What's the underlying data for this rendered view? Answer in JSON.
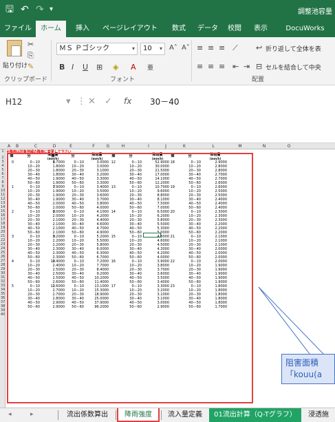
{
  "titlebar": {
    "save_icon": "save-icon",
    "undo_icon": "undo-icon",
    "redo_icon": "redo-icon",
    "customize_icon": "customize-icon",
    "window_title": "調整池容量"
  },
  "tabs": [
    "ファイル",
    "ホーム",
    "挿入",
    "ページレイアウト",
    "数式",
    "データ",
    "校閲",
    "表示",
    "DocuWorks"
  ],
  "active_tab": "ホーム",
  "ribbon": {
    "paste_label": "貼り付け",
    "clipboard_group": "クリップボード",
    "font_name": "ＭＳ Ｐゴシック",
    "font_size": "10",
    "font_group": "フォント",
    "wrap_text": "折り返して全体を表",
    "merge_center": "セルを結合して中央",
    "align_group": "配置"
  },
  "formula_bar": {
    "cell_ref": "H12",
    "fx": "fx",
    "value": "30－40"
  },
  "sheet": {
    "columns": [
      "A",
      "B",
      "C",
      "D",
      "E",
      "F",
      "G",
      "H",
      "I",
      "J",
      "K",
      "L",
      "M",
      "N",
      "O"
    ],
    "note": "※降雨は対象地域の降雨に変更して下さい",
    "headers": {
      "kou": "降",
      "bun": "分",
      "ryo": "降雨量",
      "unit": "(mm/h)"
    },
    "minutes": [
      "0－10",
      "10－20",
      "20－30",
      "30－40",
      "40－50",
      "50－60"
    ],
    "blocks": [
      {
        "row": 3,
        "groups": [
          {
            "n": "0",
            "v": [
              "1.7000",
              "1.8000",
              "1.8000",
              "1.8000",
              "1.9000",
              "1.9000"
            ]
          },
          {
            "n": "6",
            "v": [
              "3.0000",
              "3.0000",
              "3.1000",
              "3.2000",
              "3.3000",
              "3.3000"
            ]
          },
          {
            "n": "12",
            "v": [
              "52.9000",
              "30.0000",
              "21.5000",
              "17.0000",
              "14.1000",
              "12.2000"
            ]
          },
          {
            "n": "18",
            "v": [
              "2.9000",
              "2.8000",
              "2.8000",
              "2.7000",
              "2.7000",
              "2.6000"
            ]
          }
        ]
      },
      {
        "row": 9,
        "groups": [
          {
            "n": "1",
            "v": [
              "1.9000",
              "1.9000",
              "1.9000",
              "1.9000",
              "2.0000",
              "2.0000"
            ]
          },
          {
            "n": "7",
            "v": [
              "3.4000",
              "3.5000",
              "3.6000",
              "3.7000",
              "3.8000",
              "4.0000"
            ]
          },
          {
            "n": "13",
            "v": [
              "10.7000",
              "9.6000",
              "8.8000",
              "8.1000",
              "7.5000",
              "7.0000"
            ]
          },
          {
            "n": "19",
            "v": [
              "2.6000",
              "2.5000",
              "2.5000",
              "2.4000",
              "2.4000",
              "2.4000"
            ]
          }
        ]
      },
      {
        "row": 15,
        "groups": [
          {
            "n": "2",
            "v": [
              "2.0000",
              "2.0000",
              "2.1000",
              "2.1000",
              "2.1000",
              "2.1000"
            ]
          },
          {
            "n": "8",
            "v": [
              "4.1000",
              "4.2000",
              "4.4000",
              "4.6000",
              "4.7000",
              "4.9000"
            ]
          },
          {
            "n": "14",
            "v": [
              "6.5000",
              "6.2000",
              "5.8000",
              "5.5000",
              "5.3000",
              "5.0000"
            ]
          },
          {
            "n": "20",
            "v": [
              "2.3000",
              "2.3000",
              "2.3000",
              "2.2000",
              "2.2000",
              "2.2000"
            ]
          }
        ]
      },
      {
        "row": 21,
        "groups": [
          {
            "n": "3",
            "v": [
              "2.2000",
              "2.2000",
              "2.2000",
              "2.3000",
              "2.3000",
              "2.3000"
            ]
          },
          {
            "n": "9",
            "v": [
              "5.2000",
              "5.5000",
              "5.8000",
              "6.0000",
              "6.3000",
              "6.7000"
            ]
          },
          {
            "n": "15",
            "v": [
              "4.8000",
              "4.6000",
              "4.5000",
              "4.3000",
              "4.2000",
              "4.0000"
            ]
          },
          {
            "n": "21",
            "v": [
              "2.1000",
              "2.1000",
              "2.1000",
              "2.0000",
              "2.0000",
              "2.0000"
            ]
          }
        ]
      },
      {
        "row": 27,
        "groups": [
          {
            "n": "4",
            "v": [
              "2.4000",
              "2.4000",
              "2.5000",
              "2.5000",
              "2.5000",
              "2.6000"
            ]
          },
          {
            "n": "10",
            "v": [
              "7.2000",
              "7.7000",
              "8.4000",
              "9.2000",
              "10.2000",
              "11.4000"
            ]
          },
          {
            "n": "16",
            "v": [
              "3.9000",
              "3.8000",
              "3.7000",
              "3.6000",
              "3.5000",
              "3.4000"
            ]
          },
          {
            "n": "22",
            "v": [
              "2.0000",
              "1.9000",
              "1.9000",
              "1.9000",
              "1.9000",
              "1.9000"
            ]
          }
        ]
      },
      {
        "row": 33,
        "groups": [
          {
            "n": "5",
            "v": [
              "2.6000",
              "2.7000",
              "2.7000",
              "2.8000",
              "2.9000",
              "2.9000"
            ]
          },
          {
            "n": "11",
            "v": [
              "13.1000",
              "15.3000",
              "18.9000",
              "25.0000",
              "37.9000",
              "96.2000"
            ]
          },
          {
            "n": "17",
            "v": [
              "3.3000",
              "3.2000",
              "3.1000",
              "3.1000",
              "3.0000",
              "2.9000"
            ]
          },
          {
            "n": "23",
            "v": [
              "1.8000",
              "1.8000",
              "1.8000",
              "1.8000",
              "1.8000",
              "1.7000"
            ]
          }
        ]
      }
    ]
  },
  "callout": {
    "line1": "阻害面積",
    "line2": "「kouu(a"
  },
  "sheet_tabs": [
    "流出係数算出",
    "降雨強度",
    "流入量定義",
    "01流出計算（Q-Tグラフ）",
    "浸透施"
  ],
  "active_sheet": "降雨強度",
  "colors": {
    "excel_green": "#217346",
    "highlight_red": "#e04040",
    "callout_blue": "#4472c4"
  }
}
